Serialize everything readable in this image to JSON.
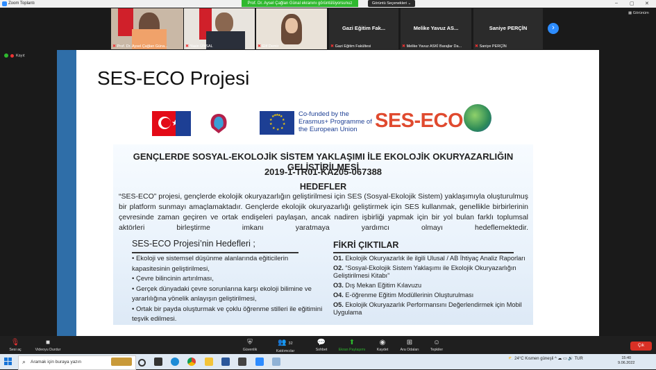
{
  "window": {
    "title": "Zoom Toplantı",
    "controls": [
      "–",
      "▢",
      "✕"
    ]
  },
  "share_banner": "Prof. Dr. Aysel Çağlan Günal ekranını görüntülüyorsunuz",
  "view_options": "Görüntü Seçenekleri ⌄",
  "gallery": {
    "view_label": "Görünüm",
    "tiles": [
      {
        "name": "Prof. Dr. Aysel Çağlan Güna...",
        "video": true
      },
      {
        "name": "Yasin ÜNSAL",
        "video": true
      },
      {
        "name": "Elif Demir",
        "video": true
      },
      {
        "big": "Gazi Eğitim Fak...",
        "name": "Gazi Eğitim Fakültesi",
        "video": false
      },
      {
        "big": "Melike Yavuz AS...",
        "name": "Melike Yavuz ASKİ Barajlar Da...",
        "video": false
      },
      {
        "big": "Saniye PERÇİN",
        "name": "Saniye PERÇİN",
        "video": false
      }
    ]
  },
  "record_label": "Kayıt",
  "slide": {
    "title": "SES-ECO Projesi",
    "eu_text": "Co-funded by the Erasmus+ Programme of the European Union",
    "brand": "SES-ECO",
    "heading": "GENÇLERDE SOSYAL-EKOLOJİK SİSTEM YAKLAŞIMI İLE EKOLOJİK OKURYAZARLIĞIN GELİŞTİRİLMESİ",
    "code": "2019-1-TR01-KA205-067388",
    "hedefler": "HEDEFLER",
    "description": "“SES-ECO” projesi, gençlerde ekolojik okuryazarlığın geliştirilmesi için SES (Sosyal-Ekolojik Sistem) yaklaşımıyla oluşturulmuş bir platform sunmayı amaçlamaktadır. Gençlerde ekolojik okuryazarlığı geliştirmek için SES kullanmak, genellikle birbirlerinin çevresinde zaman geçiren ve ortak endişeleri paylaşan, ancak nadiren işbirliği yapmak için bir yol bulan farklı toplumsal aktörleri birleştirme imkanı yaratmaya yardımcı olmayı hedeflemektedir.",
    "objectives_title": "SES-ECO Projesi’nin Hedefleri ;",
    "objectives": [
      "• Ekoloji ve sistemsel düşünme alanlarında eğiticilerin kapasitesinin geliştirilmesi,",
      "• Çevre bilincinin artırılması,",
      "• Gerçek dünyadaki çevre sorunlarına karşı ekoloji bilimine ve yararlılığına yönelik anlayışın geliştirilmesi,",
      "• Ortak bir payda oluşturmak ve çoklu öğrenme stilleri ile eğitimini teşvik edilmesi."
    ],
    "outputs_title": "FİKRİ ÇIKTILAR",
    "outputs": [
      {
        "code": "O1.",
        "text": "Ekolojik Okuryazarlık ile ilgili Ulusal / AB İhtiyaç Analiz Raporları"
      },
      {
        "code": "O2.",
        "text": "“Sosyal-Ekolojik Sistem Yaklaşımı ile Ekolojik Okuryazarlığın Geliştirilmesi Kitabı”"
      },
      {
        "code": "O3.",
        "text": "Dış Mekan Eğitim Kılavuzu"
      },
      {
        "code": "O4.",
        "text": "E-öğrenme Eğitim Modüllerinin Oluşturulması"
      },
      {
        "code": "O5.",
        "text": "Ekolojik Okuryazarlık Performansını Değerlendirmek için Mobil Uygulama"
      }
    ]
  },
  "toolbar": {
    "audio": "Sesi aç",
    "video": "Videoyu Durdur",
    "security": "Güvenlik",
    "participants": "Katılımcılar",
    "participants_count": "32",
    "chat": "Sohbet",
    "share": "Ekran Paylaşımı",
    "record": "Kaydet",
    "breakout": "Ara Odaları",
    "reactions": "Tepkiler",
    "leave": "Çık"
  },
  "taskbar": {
    "search_placeholder": "Aramak için buraya yazın",
    "weather": "24°C  Kısmen güneşli",
    "time": "15:40",
    "date": "9.06.2022"
  },
  "colors": {
    "zoom_blue": "#2d8cff",
    "share_green": "#2eb82e",
    "leave_red": "#d93025",
    "slide_bar": "#2f6ea8"
  }
}
